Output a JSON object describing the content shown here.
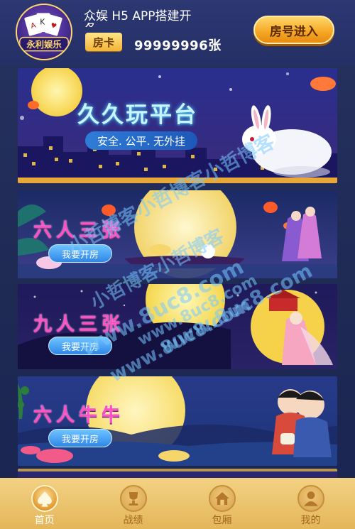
{
  "header": {
    "title": "众娱 H5 APP搭建开",
    "title_overflow": "发",
    "logo_text": "永利娱乐",
    "card_label": "房卡",
    "card_count": "99999996张",
    "join_room_label": "房号进入"
  },
  "banners": [
    {
      "title": "久久玩平台",
      "slogan": "安全. 公平. 无外挂"
    },
    {
      "title": "六人三张",
      "button": "我要开房"
    },
    {
      "title": "九人三张",
      "button": "我要开房"
    },
    {
      "title": "六人牛牛",
      "button": "我要开房"
    }
  ],
  "watermarks": [
    "小哲博客小哲博客小哲博客",
    "小哲博客小哲博客",
    "www.8uc8.com",
    "www.8uc8.com",
    "www.8uc8.com",
    "www.8uc8.com"
  ],
  "bottom_nav": [
    {
      "label": "首页",
      "icon": "spade-icon",
      "active": true
    },
    {
      "label": "战绩",
      "icon": "trophy-icon",
      "active": false
    },
    {
      "label": "包厢",
      "icon": "home-icon",
      "active": false
    },
    {
      "label": "我的",
      "icon": "user-icon",
      "active": false
    }
  ],
  "colors": {
    "accent_gold": "#f6a623",
    "title_pink": "#ff4fc6",
    "button_blue": "#2f86e8",
    "background": "#27325f"
  }
}
